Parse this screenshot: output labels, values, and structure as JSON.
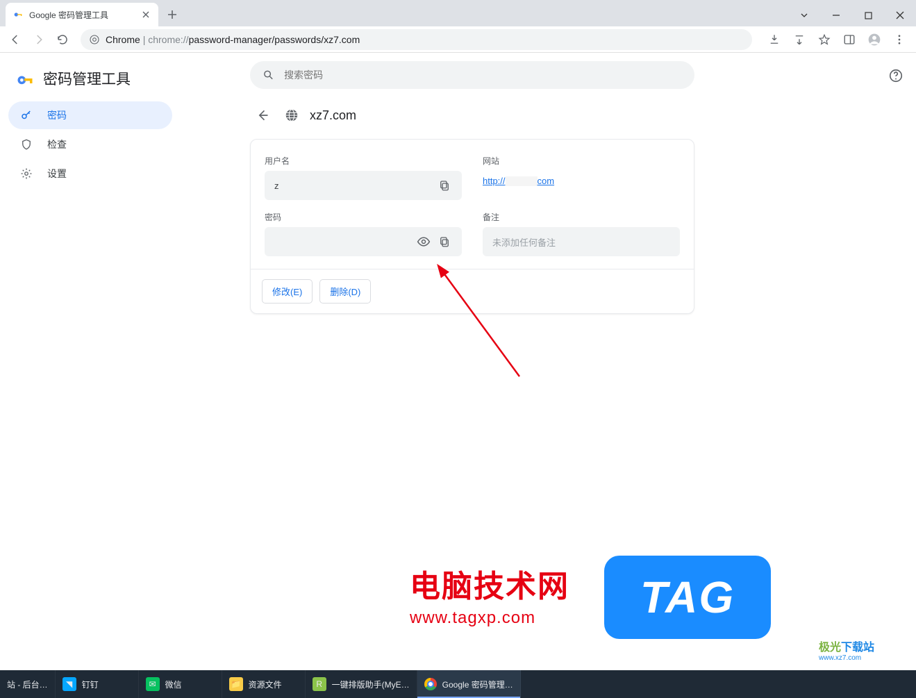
{
  "browser": {
    "tab_title": "Google 密码管理工具",
    "url_prefix": "Chrome",
    "url_dim": "chrome://",
    "url_rest": "password-manager/passwords/xz7.com"
  },
  "app": {
    "title": "密码管理工具",
    "search_placeholder": "搜索密码",
    "help_tooltip": "帮助"
  },
  "sidebar": {
    "items": [
      {
        "label": "密码"
      },
      {
        "label": "检查"
      },
      {
        "label": "设置"
      }
    ]
  },
  "page": {
    "domain": "xz7.com"
  },
  "card": {
    "username_label": "用户名",
    "username_value": "z",
    "password_label": "密码",
    "password_value": "",
    "website_label": "网站",
    "website_prefix": "http://",
    "website_suffix": "com",
    "notes_label": "备注",
    "notes_placeholder": "未添加任何备注",
    "edit_btn": "修改(E)",
    "delete_btn": "删除(D)"
  },
  "watermark": {
    "line1": "电脑技术网",
    "line2": "www.tagxp.com",
    "tag": "TAG",
    "jg1": "极光下载站",
    "jg2": "www.xz7.com"
  },
  "taskbar": {
    "items": [
      {
        "label": "站 - 后台…"
      },
      {
        "label": "钉钉"
      },
      {
        "label": "微信"
      },
      {
        "label": "资源文件"
      },
      {
        "label": "一键排版助手(MyE…"
      },
      {
        "label": "Google 密码管理…"
      }
    ]
  }
}
